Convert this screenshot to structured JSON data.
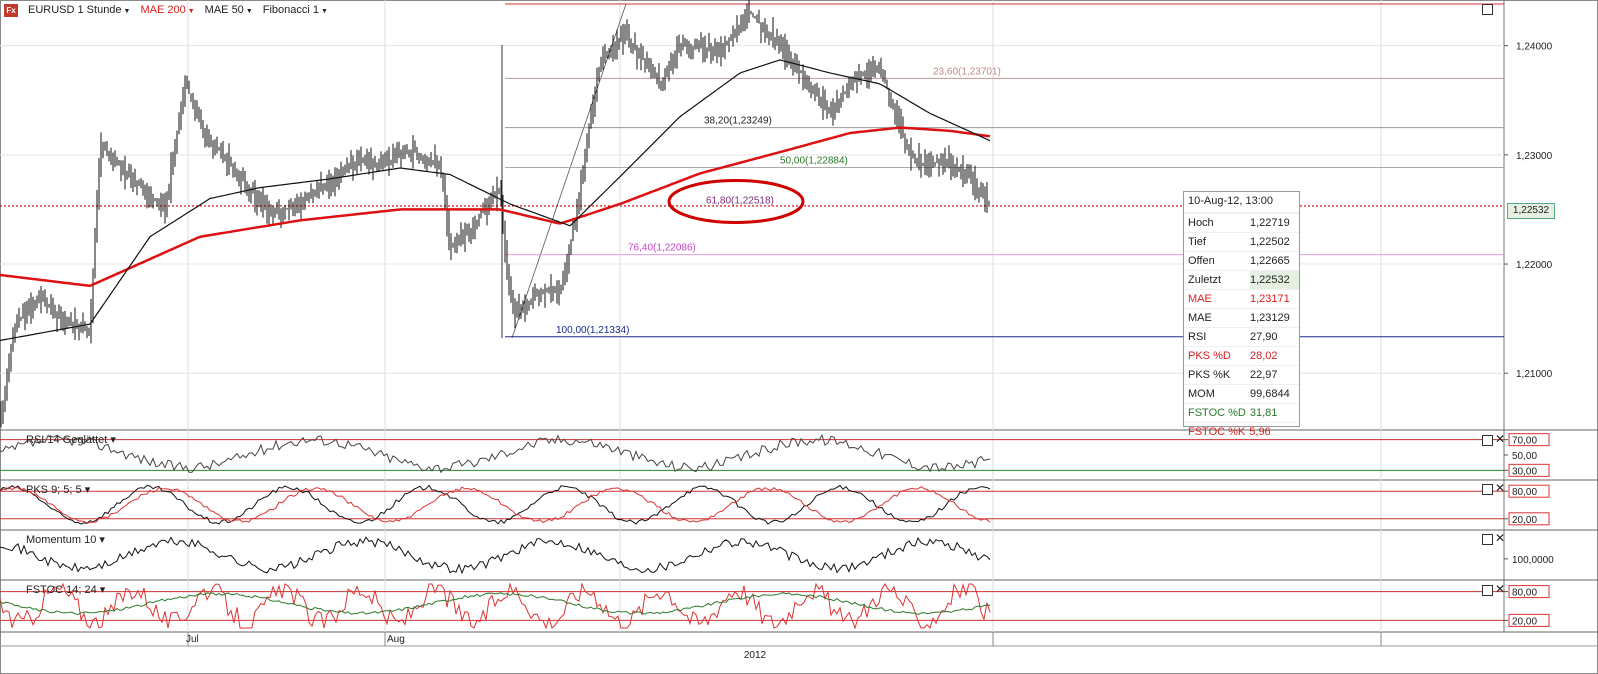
{
  "header": {
    "logo": "Fx",
    "symbol": "EURUSD 1 Stunde",
    "ind1": "MAE 200",
    "ind2": "MAE 50",
    "ind3": "Fibonacci 1"
  },
  "colors": {
    "mae200": "#dd1111",
    "mae50": "#111111",
    "highlight": "#d00000",
    "fib_green": "#2a7a2a",
    "fib_purple": "#7a2a7a",
    "fib_pink": "#cc44cc",
    "fib_blue": "#1a2a8a"
  },
  "chart_data": {
    "type": "line",
    "title": "EURUSD 1 Stunde",
    "price_axis": {
      "ticks": [
        "1,24000",
        "1,23000",
        "1,22000",
        "1,21000"
      ],
      "range": [
        1.2048,
        1.244
      ]
    },
    "last_price_label": "1,22532",
    "fibonacci": [
      {
        "label": "23,60(1,23701)",
        "value": 1.23701
      },
      {
        "label": "38,20(1,23249)",
        "value": 1.23249
      },
      {
        "label": "50,00(1,22884)",
        "value": 1.22884
      },
      {
        "label": "61,80(1,22518)",
        "value": 1.22518
      },
      {
        "label": "76,40(1,22086)",
        "value": 1.22086
      },
      {
        "label": "100,00(1,21334)",
        "value": 1.21334
      }
    ],
    "highlighted_level": "61,80(1,22518)",
    "x_labels": [
      "Jul",
      "Aug"
    ],
    "year_label": "2012",
    "price_keypoints": [
      [
        0,
        1.2055
      ],
      [
        15,
        1.2145
      ],
      [
        40,
        1.217
      ],
      [
        60,
        1.215
      ],
      [
        90,
        1.214
      ],
      [
        100,
        1.231
      ],
      [
        130,
        1.228
      ],
      [
        165,
        1.225
      ],
      [
        185,
        1.2365
      ],
      [
        205,
        1.232
      ],
      [
        240,
        1.228
      ],
      [
        270,
        1.2245
      ],
      [
        300,
        1.2255
      ],
      [
        330,
        1.2275
      ],
      [
        360,
        1.2295
      ],
      [
        380,
        1.229
      ],
      [
        410,
        1.2305
      ],
      [
        440,
        1.229
      ],
      [
        450,
        1.2215
      ],
      [
        470,
        1.223
      ],
      [
        490,
        1.226
      ],
      [
        500,
        1.227
      ],
      [
        508,
        1.218
      ],
      [
        515,
        1.2155
      ],
      [
        540,
        1.2175
      ],
      [
        560,
        1.2175
      ],
      [
        575,
        1.224
      ],
      [
        590,
        1.233
      ],
      [
        600,
        1.2385
      ],
      [
        625,
        1.241
      ],
      [
        660,
        1.2365
      ],
      [
        680,
        1.24
      ],
      [
        720,
        1.2395
      ],
      [
        750,
        1.243
      ],
      [
        780,
        1.24
      ],
      [
        805,
        1.237
      ],
      [
        830,
        1.234
      ],
      [
        855,
        1.237
      ],
      [
        880,
        1.238
      ],
      [
        895,
        1.234
      ],
      [
        910,
        1.23
      ],
      [
        925,
        1.229
      ],
      [
        945,
        1.2295
      ],
      [
        965,
        1.2285
      ],
      [
        990,
        1.2253
      ]
    ],
    "mae50_keypoints": [
      [
        0,
        1.213
      ],
      [
        90,
        1.2145
      ],
      [
        150,
        1.2225
      ],
      [
        210,
        1.226
      ],
      [
        260,
        1.227
      ],
      [
        330,
        1.2278
      ],
      [
        400,
        1.2288
      ],
      [
        450,
        1.2282
      ],
      [
        510,
        1.2255
      ],
      [
        570,
        1.2235
      ],
      [
        620,
        1.228
      ],
      [
        680,
        1.2335
      ],
      [
        740,
        1.2375
      ],
      [
        780,
        1.2387
      ],
      [
        830,
        1.2375
      ],
      [
        880,
        1.2365
      ],
      [
        930,
        1.2338
      ],
      [
        990,
        1.2313
      ]
    ],
    "mae200_keypoints": [
      [
        0,
        1.219
      ],
      [
        90,
        1.218
      ],
      [
        200,
        1.2225
      ],
      [
        300,
        1.224
      ],
      [
        400,
        1.225
      ],
      [
        500,
        1.225
      ],
      [
        560,
        1.2237
      ],
      [
        620,
        1.2255
      ],
      [
        700,
        1.2283
      ],
      [
        790,
        1.2305
      ],
      [
        850,
        1.232
      ],
      [
        900,
        1.2325
      ],
      [
        950,
        1.2322
      ],
      [
        990,
        1.2317
      ]
    ],
    "info_box": {
      "title": "10-Aug-12, 13:00",
      "rows": [
        {
          "k": "Hoch",
          "v": "1,22719",
          "color": "#222222"
        },
        {
          "k": "Tief",
          "v": "1,22502",
          "color": "#222222"
        },
        {
          "k": "Offen",
          "v": "1,22665",
          "color": "#222222"
        },
        {
          "k": "Zuletzt",
          "v": "1,22532",
          "color": "#222222"
        },
        {
          "k": "MAE",
          "v": "1,23171",
          "color": "#d92020"
        },
        {
          "k": "MAE",
          "v": "1,23129",
          "color": "#222222"
        },
        {
          "k": "RSI",
          "v": "27,90",
          "color": "#222222"
        },
        {
          "k": "PKS %D",
          "v": "28,02",
          "color": "#d92020"
        },
        {
          "k": "PKS %K",
          "v": "22,97",
          "color": "#222222"
        },
        {
          "k": "MOM",
          "v": "99,6844",
          "color": "#222222"
        },
        {
          "k": "FSTOC %D",
          "v": "31,81",
          "color": "#2a7a2a"
        },
        {
          "k": "FSTOC %K",
          "v": "5,96",
          "color": "#d92020"
        }
      ]
    },
    "sub_panels": [
      {
        "id": "rsi",
        "label": "RSI 14 Geglättet",
        "ticks": [
          "70,00",
          "50,00",
          "30,00"
        ],
        "boxed": [
          0,
          2
        ],
        "range": [
          20,
          80
        ],
        "hlines": [
          70,
          30
        ]
      },
      {
        "id": "pks",
        "label": "PKS 9; 5; 5",
        "ticks": [
          "80,00",
          "20,00"
        ],
        "boxed": [
          0,
          1
        ],
        "range": [
          0,
          100
        ],
        "hlines": [
          80,
          20
        ]
      },
      {
        "id": "mom",
        "label": "Momentum 10",
        "ticks": [
          "100,0000"
        ],
        "boxed": [],
        "range": [
          99.0,
          101.4
        ],
        "hlines": []
      },
      {
        "id": "fstoc",
        "label": "FSTOC 14; 24",
        "ticks": [
          "80,00",
          "20,00"
        ],
        "boxed": [
          0,
          1
        ],
        "range": [
          0,
          100
        ],
        "hlines": [
          80,
          20
        ]
      }
    ]
  }
}
